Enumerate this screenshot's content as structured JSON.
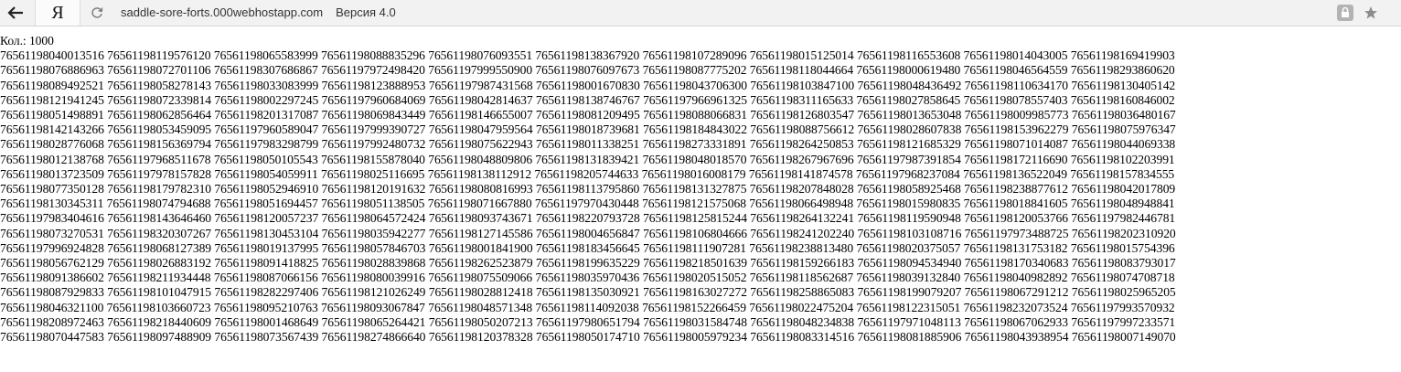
{
  "browser": {
    "tab_logo": "Я",
    "address": "saddle-sore-forts.000webhostapp.com",
    "page_title": "Версия 4.0"
  },
  "page": {
    "count_label": "Кол.: 1000",
    "rows": [
      "76561198040013516 76561198119576120 76561198065583999 76561198088835296 76561198076093551 76561198138367920 76561198107289096 76561198015125014 76561198116553608 76561198014043005 76561198169419903",
      "76561198076886963 76561198072701106 76561198307686867 76561197972498420 76561197999550900 76561198076097673 76561198087775202 76561198118044664 76561198000619480 76561198046564559 76561198293860620",
      "76561198089492521 76561198058278143 76561198033083999 76561198123888953 76561197987431568 76561198001670830 76561198043706300 76561198103847100 76561198048436492 76561198110634170 76561198130405142",
      "76561198121941245 76561198072339814 76561198002297245 76561197960684069 76561198042814637 76561198138746767 76561197966961325 76561198311165633 76561198027858645 76561198078557403 76561198160846002",
      "76561198051498891 76561198062856464 76561198201317087 76561198069843449 76561198146655007 76561198081209495 76561198088066831 76561198126803547 76561198013653048 76561198009985773 76561198036480167",
      "76561198142143266 76561198053459095 76561197960589047 76561197999390727 76561198047959564 76561198018739681 76561198184843022 76561198088756612 76561198028607838 76561198153962279 76561198075976347",
      "76561198028776068 76561198156369794 76561197983298799 76561197992480732 76561198075622943 76561198011338251 76561198273331891 76561198264250853 76561198121685329 76561198071014087 76561198044069338",
      "76561198012138768 76561197968511678 76561198050105543 76561198155878040 76561198048809806 76561198131839421 76561198048018570 76561198267967696 76561197987391854 76561198172116690 76561198102203991",
      "76561198013723509 76561197978157828 76561198054059911 76561198025116695 76561198138112912 76561198205744633 76561198016008179 76561198141874578 76561197968237084 76561198136522049 76561198157834555",
      "76561198077350128 76561198179782310 76561198052946910 76561198120191632 76561198080816993 76561198113795860 76561198131327875 76561198207848028 76561198058925468 76561198238877612 76561198042017809",
      "76561198130345311 76561198074794688 76561198051694457 76561198051138505 76561198071667880 76561197970430448 76561198121575068 76561198066498948 76561198015980835 76561198018841605 76561198048948841",
      "76561197983404616 76561198143646460 76561198120057237 76561198064572424 76561198093743671 76561198220793728 76561198125815244 76561198264132241 76561198119590948 76561198120053766 76561197982446781",
      "76561198073270531 76561198320307267 76561198130453104 76561198035942277 76561198127145586 76561198004656847 76561198106804666 76561198241202240 76561198103108716 76561197973488725 76561198202310920",
      "76561197996924828 76561198068127389 76561198019137995 76561198057846703 76561198001841900 76561198183456645 76561198111907281 76561198238813480 76561198020375057 76561198131753182 76561198015754396",
      "76561198056762129 76561198026883192 76561198091418825 76561198028839868 76561198262523879 76561198199635229 76561198218501639 76561198159266183 76561198094534940 76561198170340683 76561198083793017",
      "76561198091386602 76561198211934448 76561198087066156 76561198080039916 76561198075509066 76561198035970436 76561198020515052 76561198118562687 76561198039132840 76561198040982892 76561198074708718",
      "76561198087929833 76561198101047915 76561198282297406 76561198121026249 76561198028812418 76561198135030921 76561198163027272 76561198258865083 76561198199079207 76561198067291212 76561198025965205",
      "76561198046321100 76561198103660723 76561198095210763 76561198093067847 76561198048571348 76561198114092038 76561198152266459 76561198022475204 76561198122315051 76561198232073524 76561197993570932",
      "76561198208972463 76561198218440609 76561198001468649 76561198065264421 76561198050207213 76561197980651794 76561198031584748 76561198048234838 76561197971048113 76561198067062933 76561197997233571",
      "76561198070447583 76561198097488909 76561198073567439 76561198274866640 76561198120378328 76561198050174710 76561198005979234 76561198083314516 76561198081885906 76561198043938954 76561198007149070"
    ]
  }
}
